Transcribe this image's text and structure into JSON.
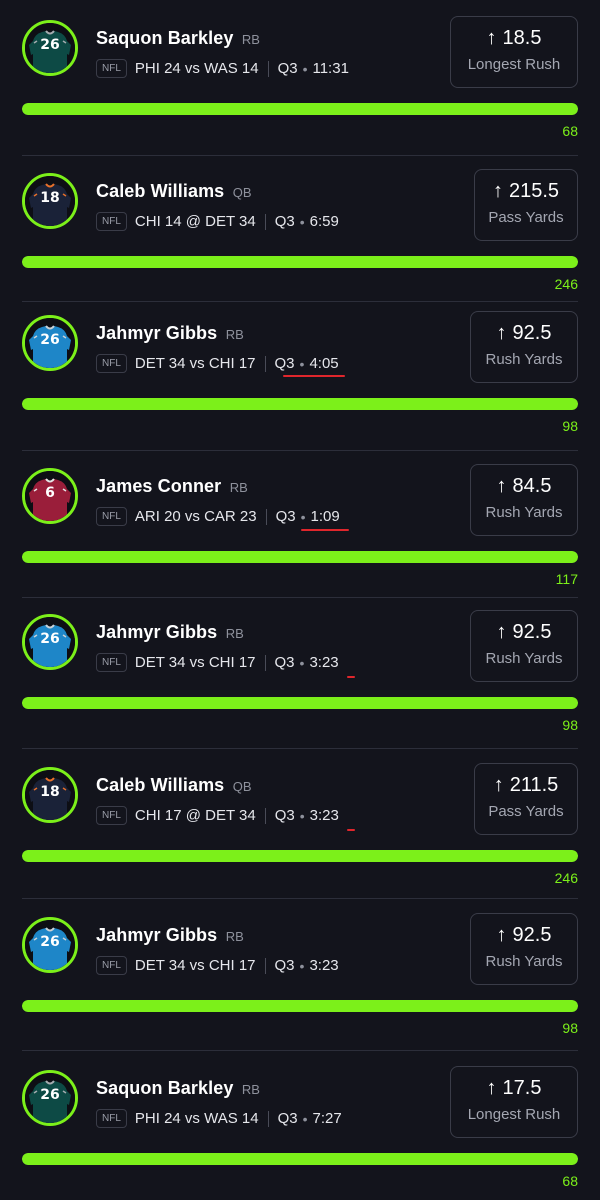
{
  "colors": {
    "background": "#13141c",
    "accent_green": "#7cf01a",
    "annotation_red": "#e0262c"
  },
  "cards": [
    {
      "player": "Saquon Barkley",
      "pos": "RB",
      "league": "NFL",
      "matchup": "PHI 24 vs WAS 14",
      "period": "Q3",
      "clock": "11:31",
      "line": "18.5",
      "stat": "Longest Rush",
      "actual": "68",
      "progress": 1.0,
      "jersey_number": "26",
      "jersey_color": "#0d4a45",
      "jersey_trim": "#a5acaf"
    },
    {
      "player": "Caleb Williams",
      "pos": "QB",
      "league": "NFL",
      "matchup": "CHI 14 @ DET 34",
      "period": "Q3",
      "clock": "6:59",
      "line": "215.5",
      "stat": "Pass Yards",
      "actual": "246",
      "progress": 1.0,
      "jersey_number": "18",
      "jersey_color": "#1a2238",
      "jersey_trim": "#e8702a"
    },
    {
      "player": "Jahmyr Gibbs",
      "pos": "RB",
      "league": "NFL",
      "matchup": "DET 34 vs CHI 17",
      "period": "Q3",
      "clock": "4:05",
      "line": "92.5",
      "stat": "Rush Yards",
      "actual": "98",
      "progress": 1.0,
      "jersey_number": "26",
      "jersey_color": "#1e86c8",
      "jersey_trim": "#c9d1d6"
    },
    {
      "player": "James Conner",
      "pos": "RB",
      "league": "NFL",
      "matchup": "ARI 20 vs CAR 23",
      "period": "Q3",
      "clock": "1:09",
      "line": "84.5",
      "stat": "Rush Yards",
      "actual": "117",
      "progress": 1.0,
      "jersey_number": "6",
      "jersey_color": "#9a1e3a",
      "jersey_trim": "#e6e6e6"
    },
    {
      "player": "Jahmyr Gibbs",
      "pos": "RB",
      "league": "NFL",
      "matchup": "DET 34 vs CHI 17",
      "period": "Q3",
      "clock": "3:23",
      "line": "92.5",
      "stat": "Rush Yards",
      "actual": "98",
      "progress": 1.0,
      "jersey_number": "26",
      "jersey_color": "#1e86c8",
      "jersey_trim": "#c9d1d6"
    },
    {
      "player": "Caleb Williams",
      "pos": "QB",
      "league": "NFL",
      "matchup": "CHI 17 @ DET 34",
      "period": "Q3",
      "clock": "3:23",
      "line": "211.5",
      "stat": "Pass Yards",
      "actual": "246",
      "progress": 1.0,
      "jersey_number": "18",
      "jersey_color": "#1a2238",
      "jersey_trim": "#e8702a"
    },
    {
      "player": "Jahmyr Gibbs",
      "pos": "RB",
      "league": "NFL",
      "matchup": "DET 34 vs CHI 17",
      "period": "Q3",
      "clock": "3:23",
      "line": "92.5",
      "stat": "Rush Yards",
      "actual": "98",
      "progress": 1.0,
      "jersey_number": "26",
      "jersey_color": "#1e86c8",
      "jersey_trim": "#c9d1d6"
    },
    {
      "player": "Saquon Barkley",
      "pos": "RB",
      "league": "NFL",
      "matchup": "PHI 24 vs WAS 14",
      "period": "Q3",
      "clock": "7:27",
      "line": "17.5",
      "stat": "Longest Rush",
      "actual": "68",
      "progress": 1.0,
      "jersey_number": "26",
      "jersey_color": "#0d4a45",
      "jersey_trim": "#a5acaf"
    }
  ],
  "icons": {
    "direction": "arrow-up-icon",
    "jersey": "jersey-icon"
  }
}
